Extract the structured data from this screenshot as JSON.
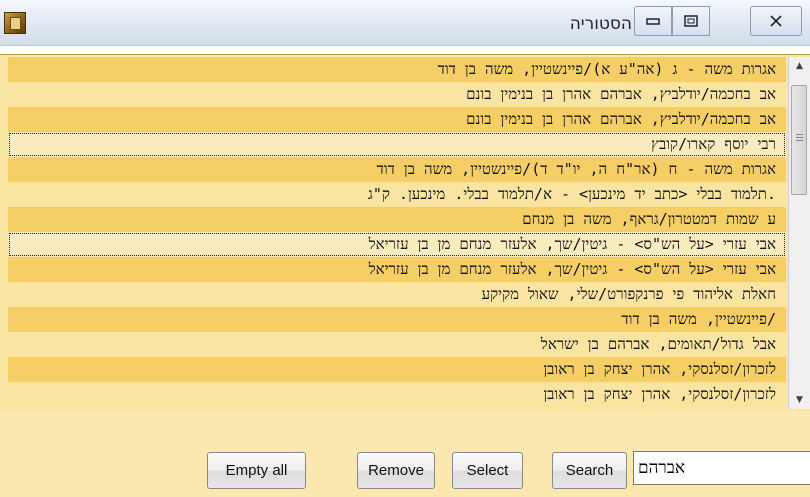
{
  "window": {
    "title": "הסטוריה",
    "app_icon": "app-book-icon",
    "buttons": {
      "minimize": "minimize-icon",
      "maximize": "maximize-icon",
      "close": "close-icon"
    }
  },
  "list": {
    "rows": [
      "אגרות משה - ג (אה\"ע א)/פיינשטיין, משה בן דוד",
      "אב בחכמה/יודלביץ, אברהם אהרן בן בנימין בונם",
      "אב בחכמה/יודלביץ, אברהם אהרן בן בנימין בונם",
      "רבי יוסף קארו/קובץ",
      "אגרות משה - ח (אר\"ח ה, יו\"ד ד)/פיינשטיין, משה בן דוד",
      ".תלמוד בבלי <כתב יד מינכען> - א/תלמוד בבלי. מינכען. ק\"ג",
      "ע שמות דמטטרון/גראף, משה בן מנחם",
      "אבי עזרי <על הש\"ס> - גיטין/שך, אלעזר מנחם מן בן עזריאל",
      "אבי עזרי <על הש\"ס> - גיטין/שך, אלעזר מנחם מן בן עזריאל",
      "חאלת אליהוד פי פרנקפורט/שלי, שאול מקיקע",
      "/פיינשטיין, משה בן דוד",
      "אבל גדול/תאומים, אברהם בן ישראל",
      "לזכרון/זסלנסקי, אהרן יצחק בן ראובן",
      "לזכרון/זסלנסקי, אהרן יצחק בן ראובן"
    ]
  },
  "toolbar": {
    "empty_all_label": "Empty all",
    "remove_label": "Remove",
    "select_label": "Select",
    "search_label": "Search",
    "search_value": "אברהם"
  },
  "colors": {
    "row_odd": "#f5cf66",
    "row_even": "#f9e4a2",
    "panel_bg": "#fbe8ae"
  }
}
